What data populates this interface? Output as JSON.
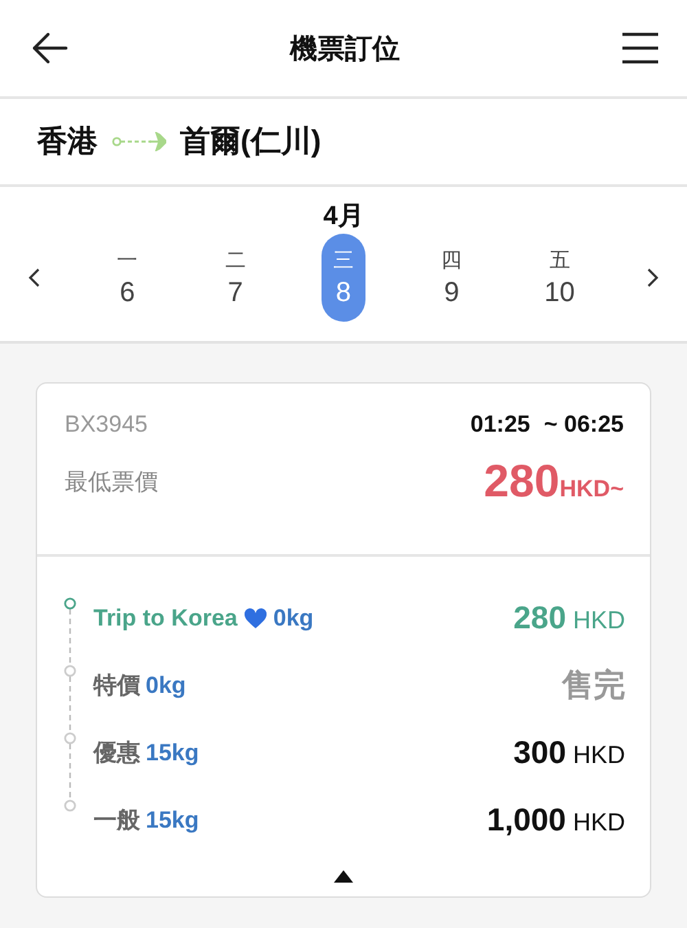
{
  "header": {
    "title": "機票訂位"
  },
  "route": {
    "from": "香港",
    "to": "首爾(仁川)"
  },
  "calendar": {
    "month": "4月",
    "days": [
      {
        "weekday": "一",
        "date": "6",
        "selected": false
      },
      {
        "weekday": "二",
        "date": "7",
        "selected": false
      },
      {
        "weekday": "三",
        "date": "8",
        "selected": true
      },
      {
        "weekday": "四",
        "date": "9",
        "selected": false
      },
      {
        "weekday": "五",
        "date": "10",
        "selected": false
      }
    ]
  },
  "flight": {
    "number": "BX3945",
    "depart": "01:25",
    "arrive": "~ 06:25",
    "lowest_label": "最低票價",
    "lowest_price": "280",
    "lowest_currency": "HKD~",
    "fares": [
      {
        "kind": "highlight",
        "name": "Trip to Korea",
        "heart": true,
        "baggage": "0kg",
        "price": "280",
        "currency": "HKD"
      },
      {
        "kind": "soldout",
        "name": "特價",
        "baggage": "0kg",
        "price": "售完"
      },
      {
        "kind": "normal",
        "name": "優惠",
        "baggage": "15kg",
        "price": "300",
        "currency": "HKD"
      },
      {
        "kind": "normal",
        "name": "一般",
        "baggage": "15kg",
        "price": "1,000",
        "currency": "HKD"
      }
    ],
    "expanded": true
  }
}
